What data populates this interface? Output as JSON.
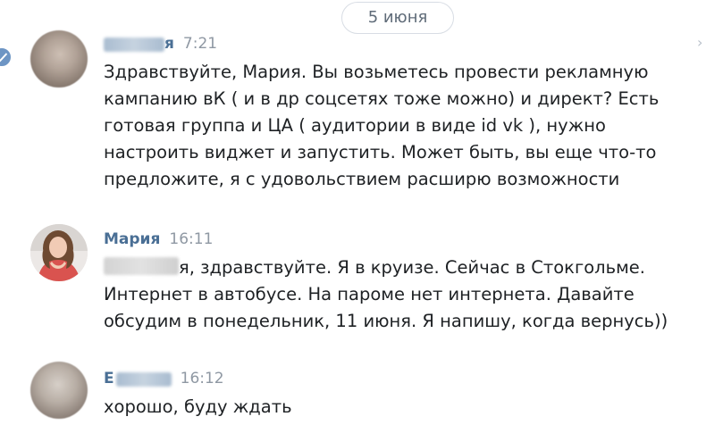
{
  "date_divider": "5 июня",
  "messages": [
    {
      "author_partial": "я",
      "time": "7:21",
      "text": "Здравствуйте, Мария. Вы возьметесь провести рекламную кампанию вК ( и в др соцсетях тоже можно) и директ? Есть готовая группа и ЦА ( аудитории в виде id vk ), нужно настроить виджет и запустить. Может быть, вы еще что-то предложите, я с удовольствием расширю возможности"
    },
    {
      "author": "Мария",
      "time": "16:11",
      "text_partial_start": "я",
      "text": ", здравствуйте. Я в круизе. Сейчас в Стокгольме. Интернет в автобусе. На пароме нет интернета. Давайте обсудим в понедельник, 11 июня. Я напишу, когда вернусь))"
    },
    {
      "author_partial": "Е",
      "time": "16:12",
      "text": "хорошо, буду ждать"
    }
  ],
  "colors": {
    "author": "#4a6f95",
    "time": "#8f98a3",
    "text": "#1e2124",
    "pill_border": "#d8dde4"
  }
}
